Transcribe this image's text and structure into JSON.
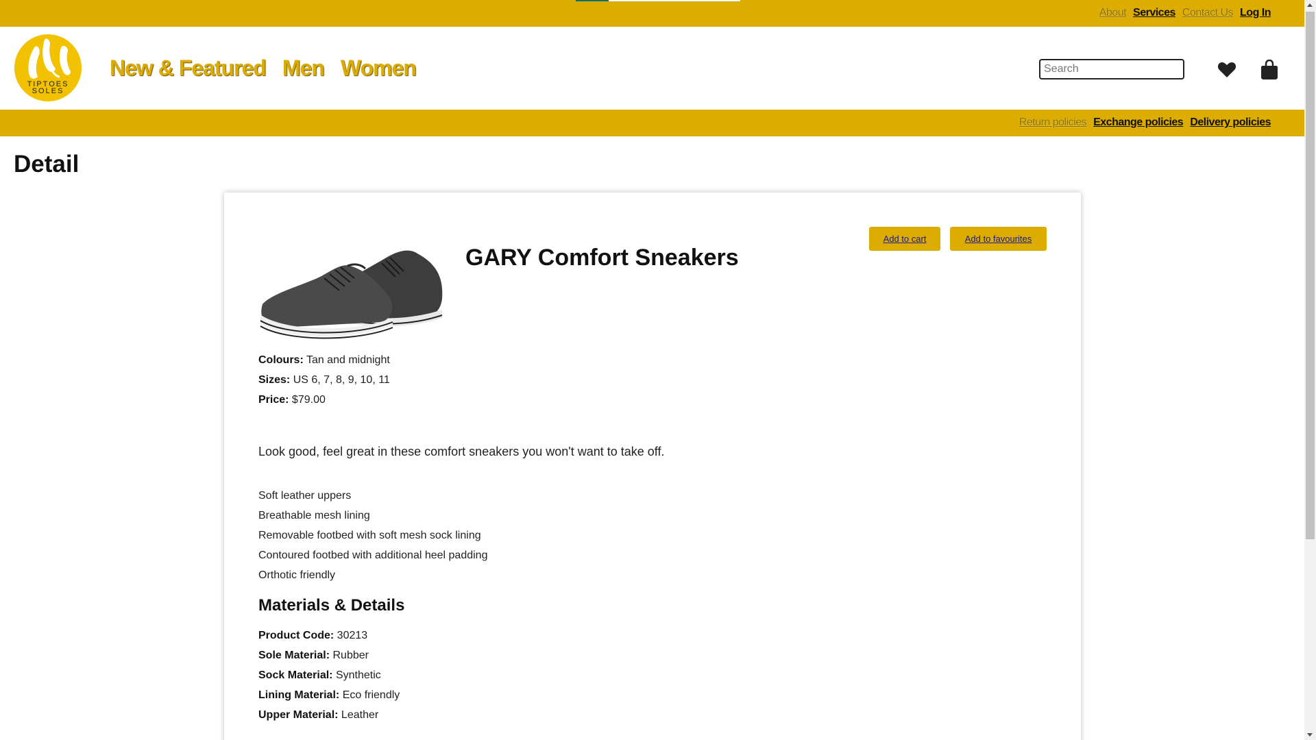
{
  "top_links": [
    {
      "label": "About",
      "style": "muted"
    },
    {
      "label": "Services",
      "style": "bold"
    },
    {
      "label": "Contact Us",
      "style": "muted"
    },
    {
      "label": "Log In",
      "style": "bold"
    }
  ],
  "logo": {
    "line1": "TIPTOES",
    "line2": "SOLES"
  },
  "main_nav": [
    "New & Featured",
    "Men",
    "Women"
  ],
  "search": {
    "placeholder": "Search",
    "value": ""
  },
  "header_icons": [
    "heart-icon",
    "shopping-bag-icon"
  ],
  "policy_links": [
    {
      "label": "Return policies",
      "style": "muted"
    },
    {
      "label": "Exchange policies",
      "style": "bold"
    },
    {
      "label": "Delivery policies",
      "style": "bold"
    }
  ],
  "page_title": "Detail",
  "product": {
    "title": "GARY Comfort Sneakers",
    "add_to_cart_label": "Add to cart",
    "add_to_favourites_label": "Add to favourites",
    "specs": [
      {
        "label": "Colours:",
        "value": "Tan and midnight"
      },
      {
        "label": "Sizes:",
        "value": "US 6, 7, 8, 9, 10, 11"
      },
      {
        "label": "Price:",
        "value": "$79.00"
      }
    ],
    "tagline": "Look good, feel great in these comfort sneakers you won't want to take off.",
    "features": [
      "Soft leather uppers",
      "Breathable mesh lining",
      "Removable footbed with soft mesh sock lining",
      "Contoured footbed with additional heel padding",
      "Orthotic friendly"
    ],
    "materials_title": "Materials & Details",
    "materials": [
      {
        "label": "Product Code:",
        "value": "30213"
      },
      {
        "label": "Sole Material:",
        "value": "Rubber"
      },
      {
        "label": "Sock Material:",
        "value": "Synthetic"
      },
      {
        "label": "Lining Material:",
        "value": "Eco friendly"
      },
      {
        "label": "Upper Material:",
        "value": "Leather"
      }
    ]
  },
  "colors": {
    "brand_yellow": "#dcac00",
    "logo_yellow": "#f2c200",
    "button_text": "#1a1a8c"
  }
}
